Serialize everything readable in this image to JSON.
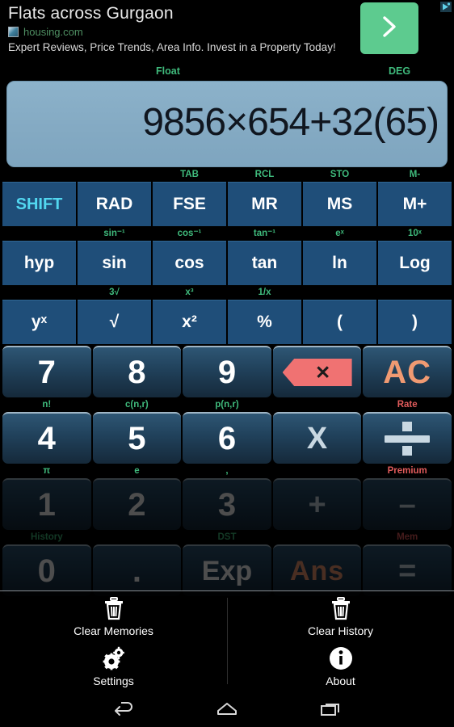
{
  "ad": {
    "title": "Flats across Gurgaon",
    "url": "housing.com",
    "description": "Expert Reviews, Price Trends, Area Info. Invest in a Property Today!",
    "cta_icon": "chevron-right-icon",
    "adchoices_icon": "adchoices-icon",
    "cta_color": "#5dcb8f"
  },
  "indicators": {
    "notation": "Float",
    "angle_unit": "DEG"
  },
  "display": {
    "expression": "9856×654+32(65)",
    "background": "#84aac3",
    "text_color": "#10161f"
  },
  "colors": {
    "function_key": "#1f4e79",
    "shift_text": "#52d7f0",
    "secondary_label": "#3fba7c",
    "premium_label": "#e05b5b",
    "accent_orange": "#f09a72",
    "backspace_red": "#f07272"
  },
  "keypad": {
    "rows": [
      {
        "labels": [
          "",
          "",
          "TAB",
          "RCL",
          "STO",
          "M-"
        ],
        "label_colors": [
          "green",
          "green",
          "green",
          "green",
          "green",
          "green"
        ],
        "keys": [
          {
            "label": "SHIFT",
            "name": "shift"
          },
          {
            "label": "RAD",
            "name": "rad"
          },
          {
            "label": "FSE",
            "name": "fse"
          },
          {
            "label": "MR",
            "name": "mr"
          },
          {
            "label": "MS",
            "name": "ms"
          },
          {
            "label": "M+",
            "name": "m-plus"
          }
        ]
      },
      {
        "labels": [
          "",
          "sin⁻¹",
          "cos⁻¹",
          "tan⁻¹",
          "eˣ",
          "10ˣ"
        ],
        "label_colors": [
          "green",
          "green",
          "green",
          "green",
          "green",
          "green"
        ],
        "keys": [
          {
            "label": "hyp",
            "name": "hyp"
          },
          {
            "label": "sin",
            "name": "sin"
          },
          {
            "label": "cos",
            "name": "cos"
          },
          {
            "label": "tan",
            "name": "tan"
          },
          {
            "label": "ln",
            "name": "ln"
          },
          {
            "label": "Log",
            "name": "log"
          }
        ]
      },
      {
        "labels": [
          "",
          "3√",
          "x³",
          "1/x",
          "",
          ""
        ],
        "label_colors": [
          "green",
          "green",
          "green",
          "green",
          "green",
          "green"
        ],
        "keys": [
          {
            "label": "yˣ",
            "name": "y-power-x"
          },
          {
            "label": "√",
            "name": "square-root"
          },
          {
            "label": "x²",
            "name": "x-squared"
          },
          {
            "label": "%",
            "name": "percent"
          },
          {
            "label": "(",
            "name": "open-paren"
          },
          {
            "label": ")",
            "name": "close-paren"
          }
        ]
      }
    ],
    "numeric_rows": [
      {
        "keys": [
          "7",
          "8",
          "9",
          "backspace",
          "AC"
        ],
        "labels": [
          "n!",
          "c(n,r)",
          "p(n,r)",
          "",
          "Rate"
        ],
        "label_colors": [
          "green",
          "green",
          "green",
          "green",
          "red"
        ]
      },
      {
        "keys": [
          "4",
          "5",
          "6",
          "X",
          "divide"
        ],
        "labels": [
          "π",
          "e",
          ",",
          "",
          "Premium"
        ],
        "label_colors": [
          "green",
          "green",
          "green",
          "green",
          "red"
        ]
      },
      {
        "keys": [
          "1",
          "2",
          "3",
          "+",
          "–"
        ],
        "labels": [
          "History",
          "",
          "DST",
          "",
          "Mem"
        ],
        "label_colors": [
          "green",
          "green",
          "green",
          "green",
          "red"
        ]
      },
      {
        "keys": [
          "0",
          ".",
          "Exp",
          "Ans",
          "="
        ],
        "labels": [
          "",
          "",
          "",
          "",
          ""
        ],
        "label_colors": [
          "green",
          "green",
          "green",
          "green",
          "green"
        ]
      }
    ]
  },
  "menu": {
    "items": [
      {
        "label": "Clear Memories",
        "icon": "trash-icon",
        "name": "clear-memories"
      },
      {
        "label": "Clear History",
        "icon": "trash-icon",
        "name": "clear-history"
      },
      {
        "label": "Settings",
        "icon": "gear-icon",
        "name": "settings"
      },
      {
        "label": "About",
        "icon": "info-icon",
        "name": "about"
      }
    ]
  },
  "navbar": {
    "back": "back-icon",
    "home": "home-icon",
    "recents": "recents-icon"
  }
}
